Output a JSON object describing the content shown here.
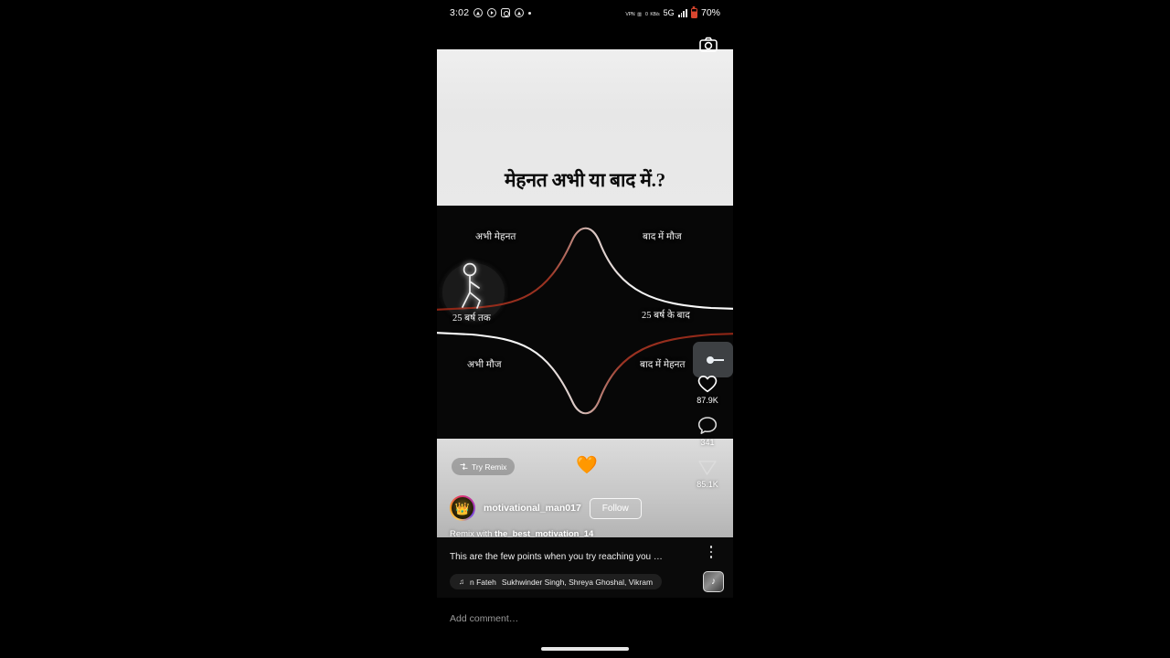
{
  "status_bar": {
    "time": "3:02",
    "icons": [
      "notification-triangle-icon",
      "play-circle-icon",
      "instagram-icon",
      "notification-triangle-icon",
      "dot-icon"
    ],
    "vpn_label": "VPN",
    "data_rate": "0",
    "data_rate_unit": "KB/s",
    "network": "5G",
    "battery_percent": "70%"
  },
  "post": {
    "headline": "मेहनत अभी या बाद में.?",
    "chart_labels": {
      "top_left": "अभी मेहनत",
      "top_right": "बाद में मौज",
      "mid_left": "25 बर्ष तक",
      "mid_right": "25 बर्ष के बाद",
      "bottom_left": "अभी मौज",
      "bottom_right": "बाद में मेहनत"
    },
    "colors": {
      "curve_red": "#8e2414",
      "curve_white": "#f2f2f2",
      "media_dark": "#070707",
      "media_light": "#e9e9e9"
    }
  },
  "actions": {
    "like": {
      "icon": "heart-icon",
      "count": "87.9K"
    },
    "comment": {
      "icon": "comment-bubble-icon",
      "count": "341"
    },
    "share": {
      "icon": "send-paper-plane-icon",
      "count": "85.1K"
    }
  },
  "info_panel": {
    "try_remix_label": "Try Remix",
    "remix_icon": "remix-shuffle-icon",
    "reaction_emoji": "🧡",
    "username": "motivational_man017",
    "follow_label": "Follow",
    "remix_credit_prefix": "Remix with ",
    "remix_credit_user": "the_best_motivation_14"
  },
  "caption": {
    "text": "This are the few points when you try reaching you …",
    "menu_icon": "kebab-menu-icon"
  },
  "music": {
    "note_icon": "music-note-icon",
    "title": "n Fateh",
    "artists": "Sukhwinder Singh, Shreya Ghoshal, Vikram",
    "thumbnail_icon": "album-art-icon"
  },
  "comment_bar": {
    "placeholder": "Add comment…"
  },
  "camera_icon": "camera-icon"
}
